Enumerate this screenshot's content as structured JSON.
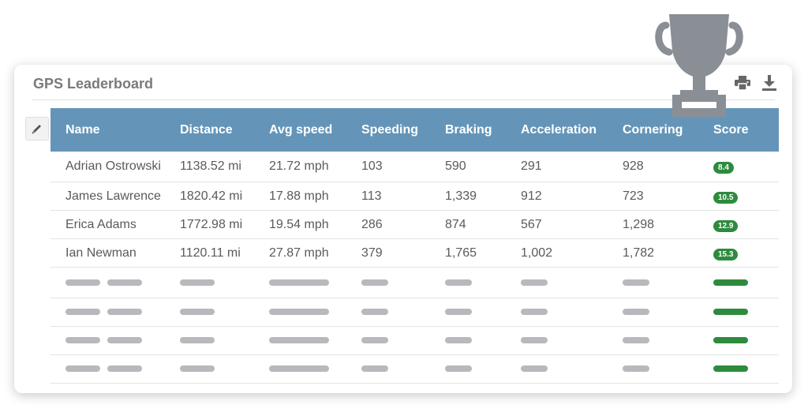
{
  "card": {
    "title": "GPS Leaderboard"
  },
  "icons": {
    "edit": "pencil-icon",
    "print": "printer-icon",
    "download": "download-icon",
    "trophy": "trophy-icon"
  },
  "table": {
    "columns": [
      "Name",
      "Distance",
      "Avg speed",
      "Speeding",
      "Braking",
      "Acceleration",
      "Cornering",
      "Score"
    ],
    "rows": [
      {
        "name": "Adrian Ostrowski",
        "distance": "1138.52 mi",
        "avg_speed": "21.72 mph",
        "speeding": "103",
        "braking": "590",
        "acceleration": "291",
        "cornering": "928",
        "score": "8.4"
      },
      {
        "name": "James Lawrence",
        "distance": "1820.42 mi",
        "avg_speed": "17.88 mph",
        "speeding": "113",
        "braking": "1,339",
        "acceleration": "912",
        "cornering": "723",
        "score": "10.5"
      },
      {
        "name": "Erica Adams",
        "distance": "1772.98 mi",
        "avg_speed": "19.54 mph",
        "speeding": "286",
        "braking": "874",
        "acceleration": "567",
        "cornering": "1,298",
        "score": "12.9"
      },
      {
        "name": "Ian Newman",
        "distance": "1120.11 mi",
        "avg_speed": "27.87 mph",
        "speeding": "379",
        "braking": "1,765",
        "acceleration": "1,002",
        "cornering": "1,782",
        "score": "15.3"
      }
    ],
    "placeholder_rows": 4
  },
  "colors": {
    "header": "#6495b9",
    "score": "#2e8b3e",
    "placeholder": "#b7b9bc",
    "trophy": "#8a8f96"
  }
}
